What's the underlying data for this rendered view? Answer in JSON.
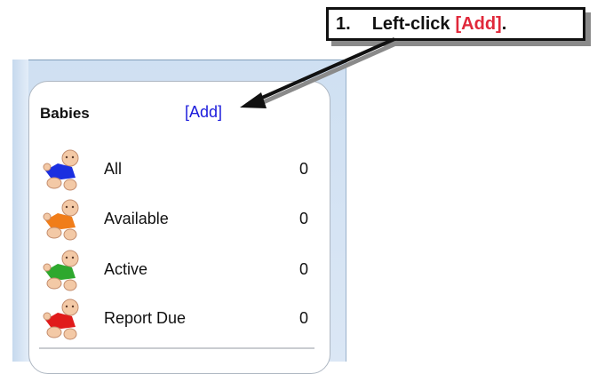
{
  "callout": {
    "step": "1.",
    "verb": "Left-click",
    "target": "[Add]",
    "trail": "."
  },
  "panel": {
    "title": "Babies",
    "add_label": "[Add]",
    "items": [
      {
        "label": "All",
        "count": "0",
        "icon": "baby-blue-shirt-icon",
        "shirt_color": "#1a2fe0"
      },
      {
        "label": "Available",
        "count": "0",
        "icon": "baby-orange-shirt-icon",
        "shirt_color": "#f07d1a"
      },
      {
        "label": "Active",
        "count": "0",
        "icon": "baby-green-shirt-icon",
        "shirt_color": "#2ea82e"
      },
      {
        "label": "Report Due",
        "count": "0",
        "icon": "baby-red-shirt-icon",
        "shirt_color": "#e01b1b"
      }
    ]
  },
  "colors": {
    "link": "#1c1cdc",
    "highlight": "#e0283a",
    "window_bg": "#d6e4f3"
  }
}
